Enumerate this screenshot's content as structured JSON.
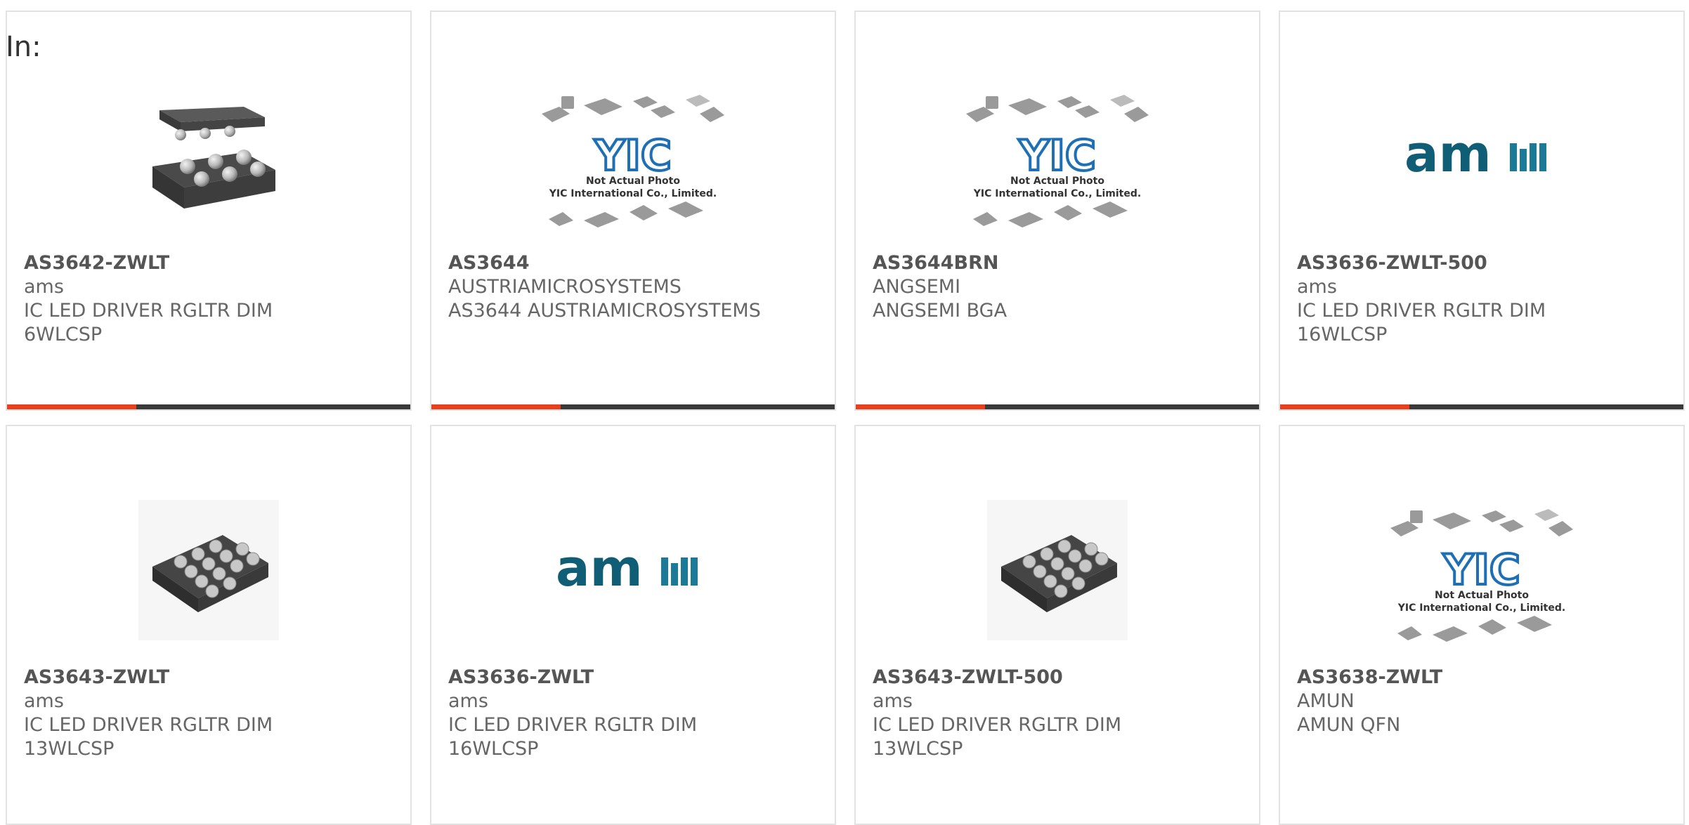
{
  "filter_label": "In:",
  "colors": {
    "accent": "#e8401c",
    "bar_track": "#3a3a3a",
    "ams_teal": "#0f5e76",
    "yic_blue": "#1f6fb5"
  },
  "products": [
    {
      "part": "AS3642-ZWLT",
      "mfr": "ams",
      "desc_line1": "IC LED DRIVER RGLTR DIM",
      "desc_line2": "6WLCSP",
      "image": "wlcsp-6-chip",
      "progress": 0.32
    },
    {
      "part": "AS3644",
      "mfr": "AUSTRIAMICROSYSTEMS",
      "desc_line1": "AS3644 AUSTRIAMICROSYSTEMS",
      "desc_line2": "",
      "image": "yic-placeholder",
      "image_text1": "Not Actual Photo",
      "image_text2": "YIC International Co., Limited.",
      "progress": 0.32
    },
    {
      "part": "AS3644BRN",
      "mfr": "ANGSEMI",
      "desc_line1": "ANGSEMI BGA",
      "desc_line2": "",
      "image": "yic-placeholder",
      "image_text1": "Not Actual Photo",
      "image_text2": "YIC International Co., Limited.",
      "progress": 0.32
    },
    {
      "part": "AS3636-ZWLT-500",
      "mfr": "ams",
      "desc_line1": "IC LED DRIVER RGLTR DIM",
      "desc_line2": "16WLCSP",
      "image": "ams-logo",
      "logo_text": "am",
      "progress": 0.32
    },
    {
      "part": "AS3643-ZWLT",
      "mfr": "ams",
      "desc_line1": "IC LED DRIVER RGLTR DIM",
      "desc_line2": "13WLCSP",
      "image": "wlcsp-13-chip"
    },
    {
      "part": "AS3636-ZWLT",
      "mfr": "ams",
      "desc_line1": "IC LED DRIVER RGLTR DIM",
      "desc_line2": "16WLCSP",
      "image": "ams-logo",
      "logo_text": "am"
    },
    {
      "part": "AS3643-ZWLT-500",
      "mfr": "ams",
      "desc_line1": "IC LED DRIVER RGLTR DIM",
      "desc_line2": "13WLCSP",
      "image": "wlcsp-13-chip"
    },
    {
      "part": "AS3638-ZWLT",
      "mfr": "AMUN",
      "desc_line1": "AMUN QFN",
      "desc_line2": "",
      "image": "yic-placeholder",
      "image_text1": "Not Actual Photo",
      "image_text2": "YIC International Co., Limited."
    }
  ]
}
